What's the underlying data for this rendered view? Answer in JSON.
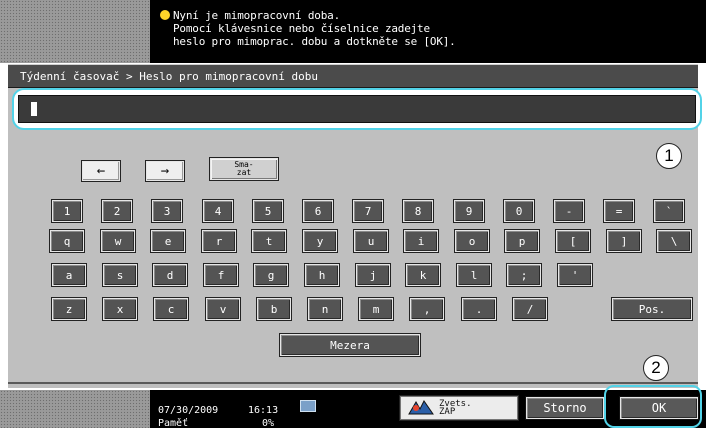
{
  "message": {
    "line1": "Nyní je mimopracovní doba.",
    "line2": "Pomocí klávesnice nebo číselnice zadejte",
    "line3": "heslo pro mimoprac. dobu a dotkněte se [OK]."
  },
  "breadcrumb": "Týdenní časovač > Heslo pro mimopracovní dobu",
  "input": {
    "value": ""
  },
  "callouts": [
    "1",
    "2"
  ],
  "keyboard": {
    "nav": {
      "left": "←",
      "right": "→",
      "backspace_line1": "Sma-",
      "backspace_line2": "zat"
    },
    "row1": [
      "1",
      "2",
      "3",
      "4",
      "5",
      "6",
      "7",
      "8",
      "9",
      "0",
      "-",
      "=",
      "`"
    ],
    "row2": [
      "q",
      "w",
      "e",
      "r",
      "t",
      "y",
      "u",
      "i",
      "o",
      "p",
      "[",
      "]",
      "\\"
    ],
    "row3": [
      "a",
      "s",
      "d",
      "f",
      "g",
      "h",
      "j",
      "k",
      "l",
      ";",
      "'"
    ],
    "row4": [
      "z",
      "x",
      "c",
      "v",
      "b",
      "n",
      "m",
      ",",
      ".",
      "/"
    ],
    "shift": "Pos.",
    "space": "Mezera"
  },
  "status": {
    "date": "07/30/2009",
    "time": "16:13",
    "memory_label": "Paměť",
    "memory_value": "0%"
  },
  "buttons": {
    "zoom_line1": "Zvets.",
    "zoom_line2": "ZAP",
    "cancel": "Storno",
    "ok": "OK"
  },
  "colors": {
    "highlight": "#52d3e8",
    "key": "#545454",
    "message_bar": "#000000"
  }
}
